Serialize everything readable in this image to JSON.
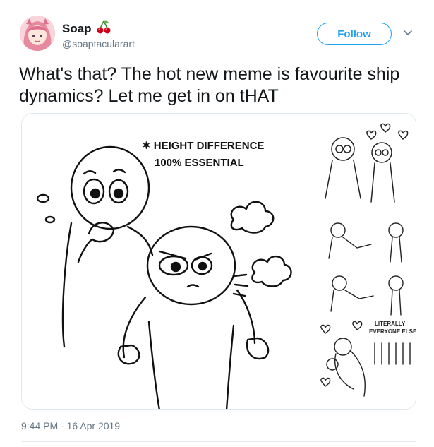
{
  "tweet": {
    "display_name": "Soap",
    "handle": "@soaptacularart",
    "follow_label": "Follow",
    "text": "What's that? The hot new meme is favourite ship dynamics? Let me get in on tHAT",
    "timestamp": "9:44 PM - 16 Apr 2019"
  },
  "media": {
    "main_caption_line1": "✶ HEIGHT DIFFERENCE",
    "main_caption_line2": "100% ESSENTIAL",
    "thumb4_caption_line1": "LITERALLY",
    "thumb4_caption_line2": "EVERYONE ELSE"
  },
  "colors": {
    "accent": "#1da1f2",
    "handle_gray": "#657786",
    "cherry_red": "#d0021b",
    "avatar_pink": "#f6c7cf"
  },
  "icons": {
    "name_badge": "cherry-emoji-icon",
    "menu": "chevron-down-icon"
  }
}
